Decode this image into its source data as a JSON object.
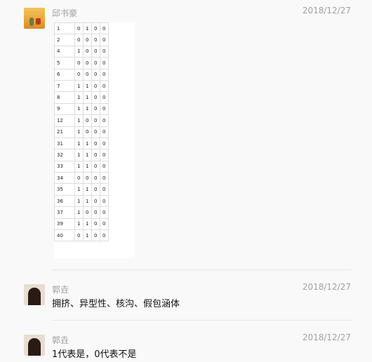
{
  "messages": [
    {
      "sender": "邱书豪",
      "date": "2018/12/27",
      "type": "image",
      "table": [
        [
          "1",
          "0",
          "1",
          "0",
          "0"
        ],
        [
          "2",
          "0",
          "0",
          "0",
          "0"
        ],
        [
          "4",
          "1",
          "0",
          "0",
          "0"
        ],
        [
          "5",
          "0",
          "0",
          "0",
          "0"
        ],
        [
          "6",
          "0",
          "0",
          "0",
          "0"
        ],
        [
          "7",
          "1",
          "1",
          "0",
          "0"
        ],
        [
          "8",
          "1",
          "1",
          "0",
          "0"
        ],
        [
          "9",
          "1",
          "1",
          "0",
          "0"
        ],
        [
          "12",
          "1",
          "0",
          "0",
          "0"
        ],
        [
          "21",
          "1",
          "0",
          "0",
          "0"
        ],
        [
          "31",
          "1",
          "1",
          "0",
          "0"
        ],
        [
          "32",
          "1",
          "1",
          "0",
          "0"
        ],
        [
          "33",
          "1",
          "1",
          "0",
          "0"
        ],
        [
          "34",
          "0",
          "0",
          "0",
          "0"
        ],
        [
          "35",
          "1",
          "1",
          "0",
          "0"
        ],
        [
          "36",
          "1",
          "1",
          "0",
          "0"
        ],
        [
          "37",
          "1",
          "0",
          "0",
          "0"
        ],
        [
          "39",
          "1",
          "1",
          "0",
          "0"
        ],
        [
          "40",
          "0",
          "1",
          "0",
          "0"
        ]
      ]
    },
    {
      "sender": "郭垚",
      "date": "2018/12/27",
      "text": "拥挤、异型性、核沟、假包涵体"
    },
    {
      "sender": "郭垚",
      "date": "2018/12/27",
      "text": "1代表是，0代表不是"
    }
  ]
}
